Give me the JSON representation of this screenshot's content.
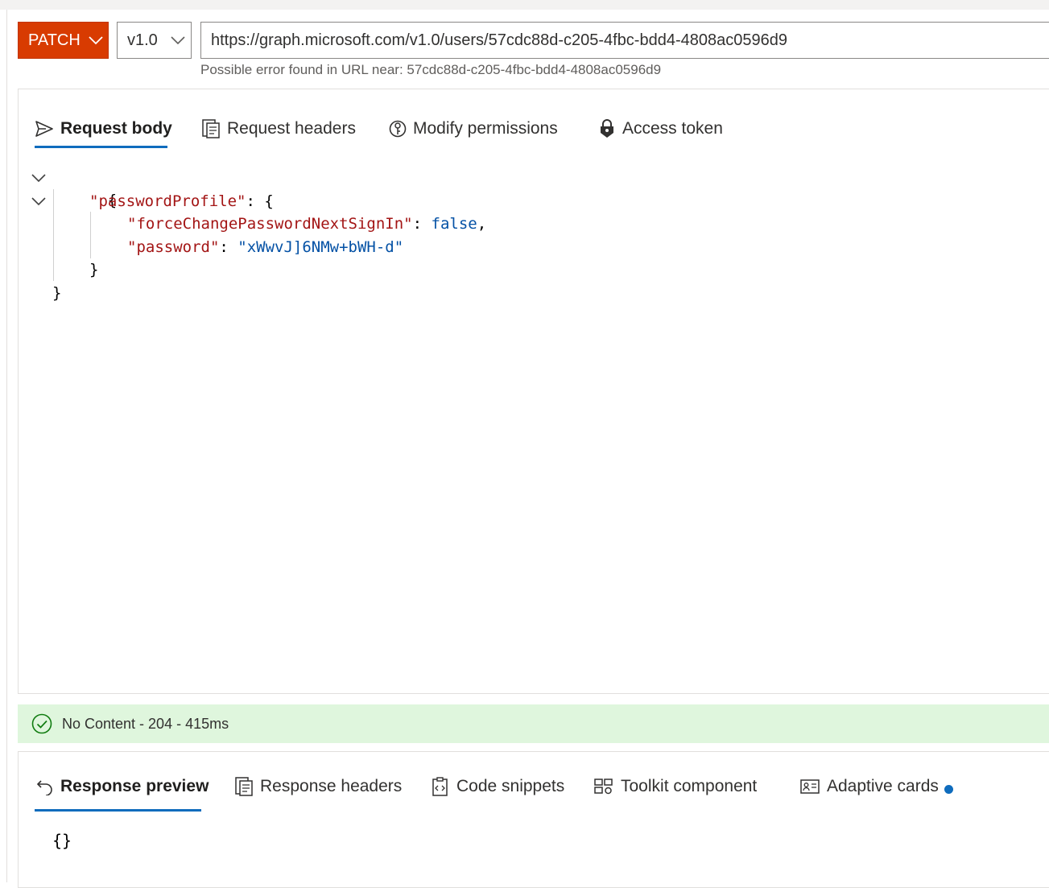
{
  "query": {
    "method": "PATCH",
    "version": "v1.0",
    "url": "https://graph.microsoft.com/v1.0/users/57cdc88d-c205-4fbc-bdd4-4808ac0596d9",
    "url_error": "Possible error found in URL near: 57cdc88d-c205-4fbc-bdd4-4808ac0596d9"
  },
  "request_tabs": [
    {
      "label": "Request body",
      "icon": "send-icon",
      "active": true
    },
    {
      "label": "Request headers",
      "icon": "document-header-icon",
      "active": false
    },
    {
      "label": "Modify permissions",
      "icon": "key-lock-icon",
      "active": false
    },
    {
      "label": "Access token",
      "icon": "lock-shield-icon",
      "active": false
    }
  ],
  "request_body": {
    "open_brace": "{",
    "key_password_profile": "\"passwordProfile\"",
    "colon_brace": ": {",
    "key_force_change": "\"forceChangePasswordNextSignIn\"",
    "colon": ": ",
    "value_force_change": "false",
    "comma": ",",
    "key_password": "\"password\"",
    "value_password": "\"xWwvJ]6NMw+bWH-d\"",
    "close_inner": "}",
    "close_outer": "}"
  },
  "status": {
    "text": "No Content - 204 - 415ms",
    "icon": "check-circle-icon",
    "color": "#dff6dd"
  },
  "response_tabs": [
    {
      "label": "Response preview",
      "icon": "undo-arrow-icon",
      "active": true
    },
    {
      "label": "Response headers",
      "icon": "document-header-icon",
      "active": false
    },
    {
      "label": "Code snippets",
      "icon": "clipboard-code-icon",
      "active": false
    },
    {
      "label": "Toolkit component",
      "icon": "toolkit-icon",
      "active": false
    },
    {
      "label": "Adaptive cards",
      "icon": "contact-card-icon",
      "active": false
    }
  ],
  "response_body": "{}",
  "colors": {
    "method": "#d83b01",
    "accent": "#0f6cbd"
  }
}
